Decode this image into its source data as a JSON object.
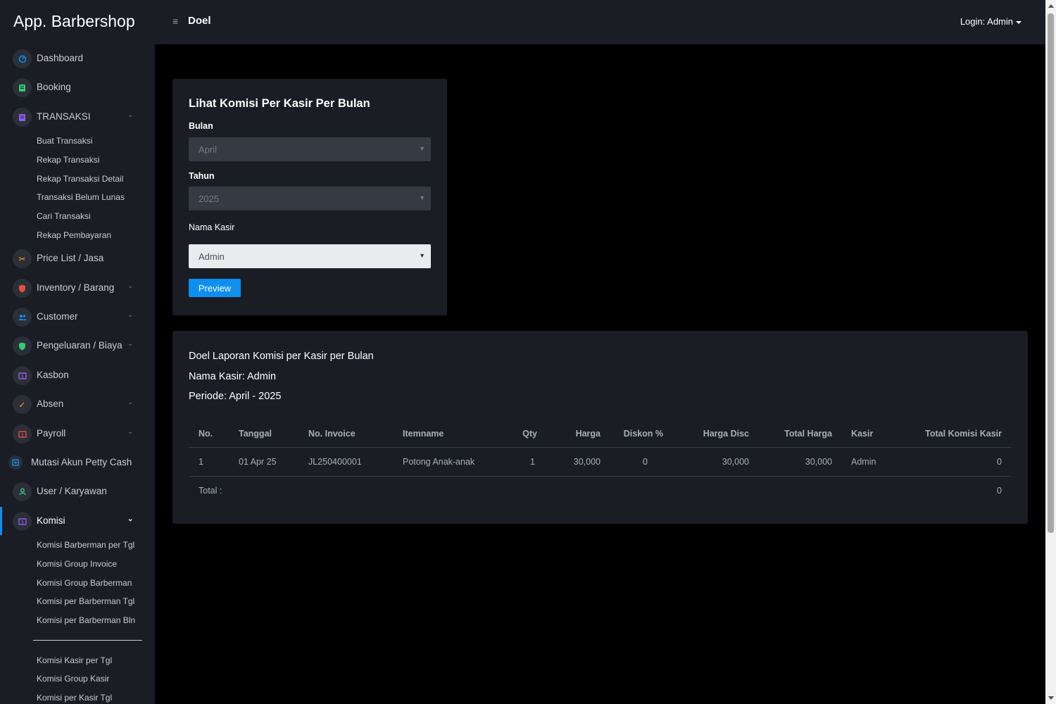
{
  "header": {
    "brand": "App. Barbershop",
    "menu_icon": "≡",
    "site_title": "Doel",
    "login_label": "Login: Admin"
  },
  "sidebar": {
    "items": [
      {
        "label": "Dashboard",
        "icon": "gauge-icon",
        "icon_color": "#0d8ff0"
      },
      {
        "label": "Booking",
        "icon": "document-icon",
        "icon_color": "#2ecc71"
      },
      {
        "label": "TRANSAKSI",
        "icon": "receipt-icon",
        "icon_color": "#8e5cf0"
      },
      {
        "label": "Price List / Jasa",
        "icon": "scissors-icon",
        "icon_color": "#f0a020"
      },
      {
        "label": "Inventory / Barang",
        "icon": "shield-icon",
        "icon_color": "#e74c3c"
      },
      {
        "label": "Customer",
        "icon": "people-icon",
        "icon_color": "#0d8ff0"
      },
      {
        "label": "Pengeluaran / Biaya",
        "icon": "shield-check-icon",
        "icon_color": "#2ecc71"
      },
      {
        "label": "Kasbon",
        "icon": "money-icon",
        "icon_color": "#8e5cf0"
      },
      {
        "label": "Absen",
        "icon": "check-icon",
        "icon_color": "#f0a020"
      },
      {
        "label": "Payroll",
        "icon": "payroll-icon",
        "icon_color": "#e74c3c"
      },
      {
        "label": "Mutasi Akun Petty Cash",
        "icon": "cash-icon",
        "icon_color": "#0d8ff0"
      },
      {
        "label": "User / Karyawan",
        "icon": "user-icon",
        "icon_color": "#2ecc71"
      },
      {
        "label": "Komisi",
        "icon": "money-icon",
        "icon_color": "#8e5cf0"
      }
    ],
    "transaksi_sub": [
      "Buat Transaksi",
      "Rekap Transaksi",
      "Rekap Transaksi Detail",
      "Transaksi Belum Lunas",
      "Cari Transaksi",
      "Rekap Pembayaran"
    ],
    "komisi_sub_a": [
      "Komisi Barberman per Tgl",
      "Komisi Group Invoice",
      "Komisi Group Barberman",
      "Komisi per Barberman Tgl",
      "Komisi per Barberman Bln"
    ],
    "komisi_sub_b": [
      "Komisi Kasir per Tgl",
      "Komisi Group Kasir",
      "Komisi per Kasir Tgl"
    ]
  },
  "filter": {
    "title": "Lihat Komisi Per Kasir Per Bulan",
    "bulan_label": "Bulan",
    "bulan_value": "April",
    "tahun_label": "Tahun",
    "tahun_value": "2025",
    "kasir_label": "Nama Kasir",
    "kasir_value": "Admin",
    "preview_label": "Preview"
  },
  "report": {
    "title": "Doel Laporan Komisi per Kasir per Bulan",
    "kasir_line": "Nama Kasir: Admin",
    "periode_line": "Periode: April - 2025",
    "columns": [
      "No.",
      "Tanggal",
      "No. Invoice",
      "Itemname",
      "Qty",
      "Harga",
      "Diskon %",
      "Harga Disc",
      "Total Harga",
      "Kasir",
      "Total Komisi Kasir"
    ],
    "rows": [
      [
        "1",
        "01 Apr 25",
        "JL250400001",
        "Potong Anak-anak",
        "1",
        "30,000",
        "0",
        "30,000",
        "30,000",
        "Admin",
        "0"
      ]
    ],
    "total_label": "Total :",
    "total_value": "0"
  }
}
